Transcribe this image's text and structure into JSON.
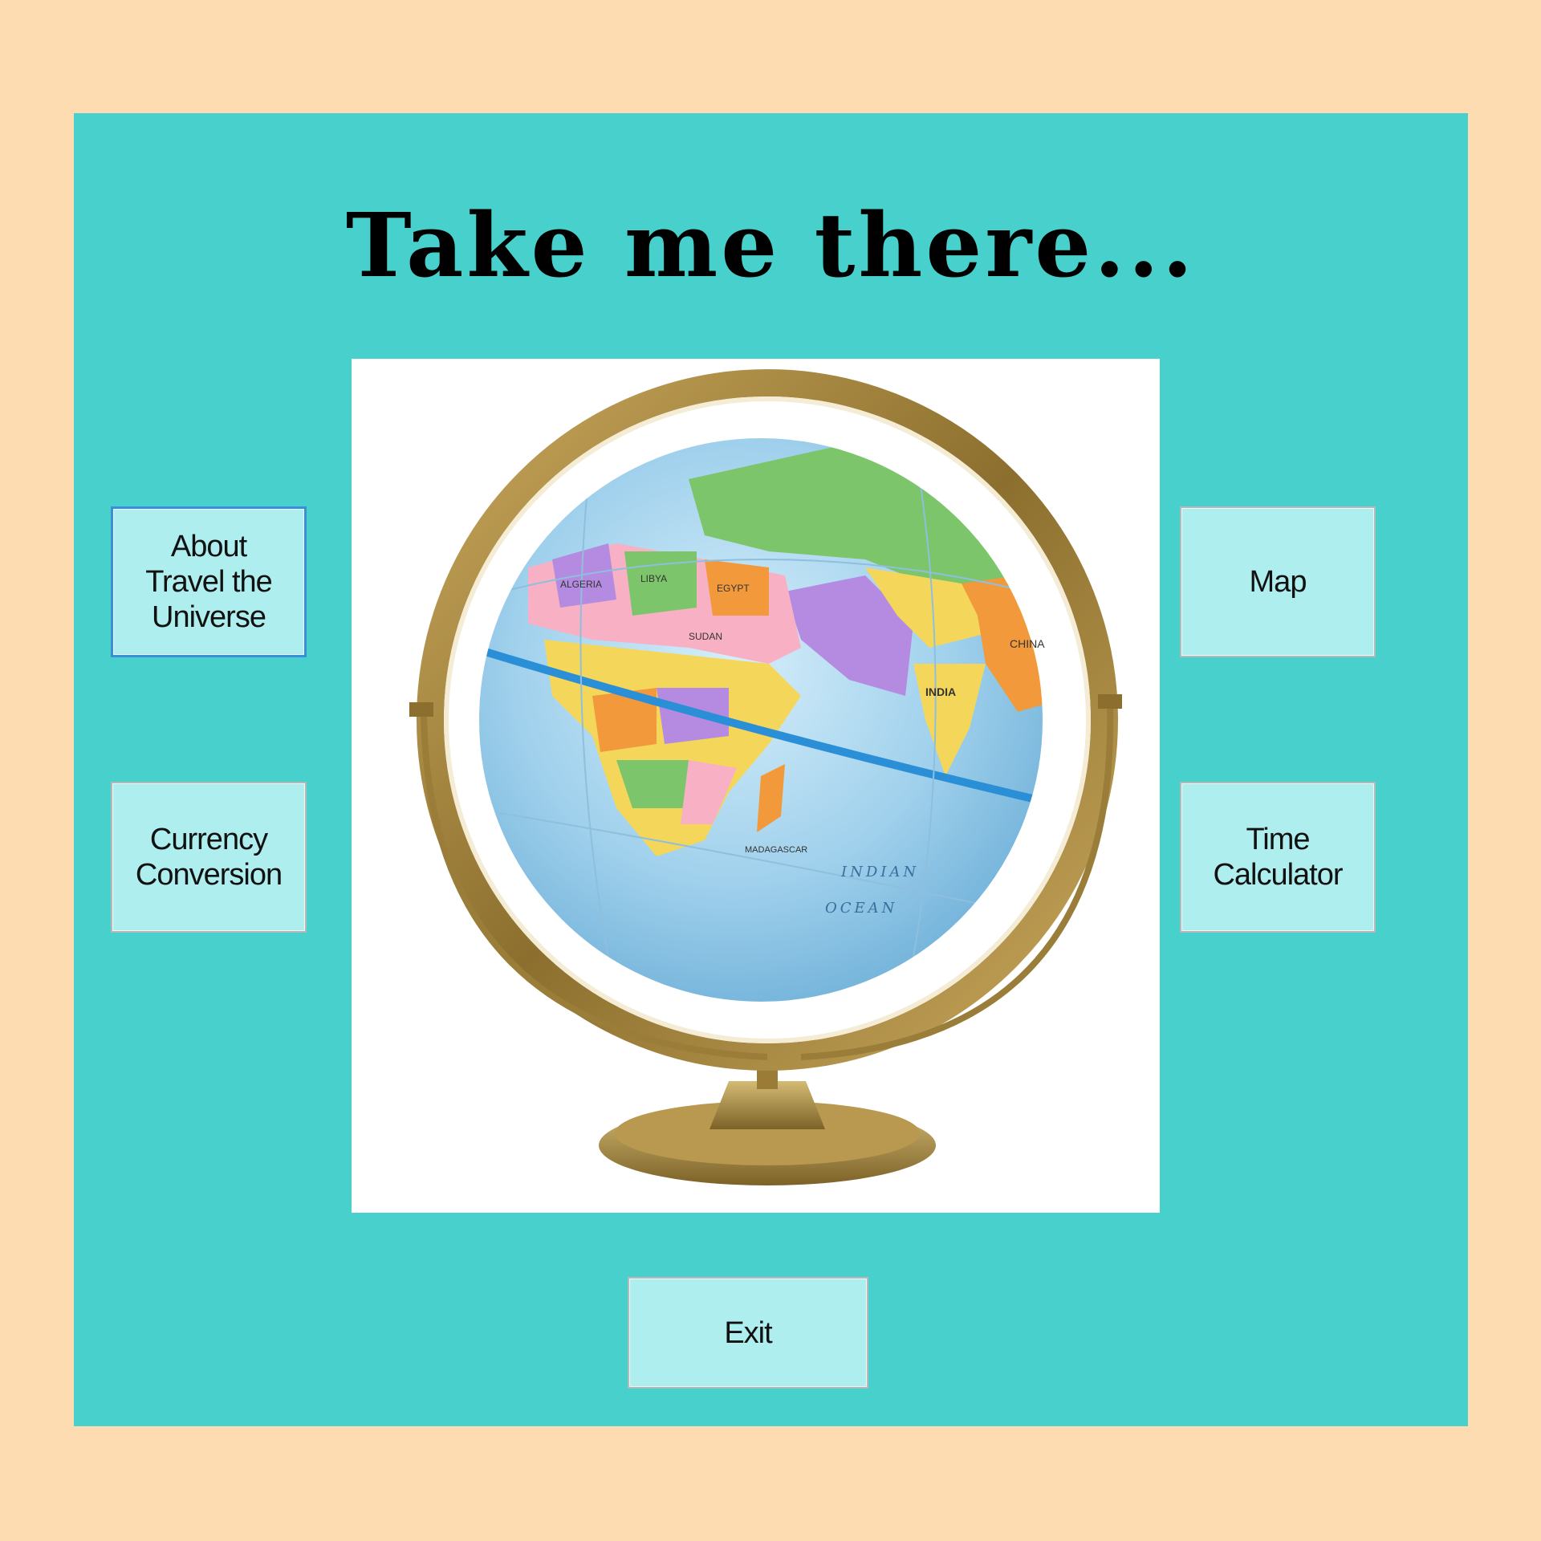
{
  "title": "Take me there...",
  "buttons": {
    "about": "About\nTravel the\nUniverse",
    "currency": "Currency\nConversion",
    "map": "Map",
    "time": "Time\nCalculator",
    "exit": "Exit"
  },
  "image": {
    "description_icon": "globe-icon",
    "labels": {
      "algeria": "ALGERIA",
      "libya": "LIBYA",
      "egypt": "EGYPT",
      "sudan": "SUDAN",
      "india": "INDIA",
      "china": "CHINA",
      "indian_ocean_1": "INDIAN",
      "indian_ocean_2": "OCEAN",
      "madagascar": "MADAGASCAR"
    }
  },
  "colors": {
    "background": "#FCDCB0",
    "panel": "#48D1CC",
    "button": "#AFEEEE",
    "focus_border": "#3b8fd6"
  }
}
